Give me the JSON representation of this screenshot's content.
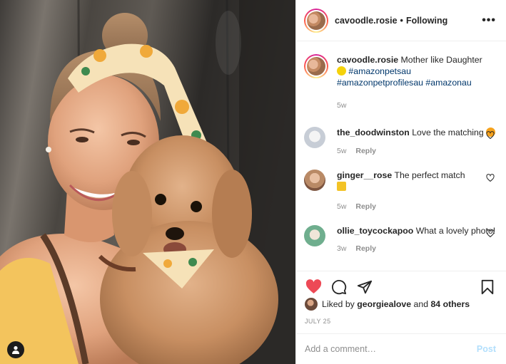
{
  "post": {
    "username": "cavoodle.rosie",
    "follow_status": "Following",
    "separator": "•",
    "more_label": "•••",
    "caption": {
      "username": "cavoodle.rosie",
      "text": "Mother like Daughter",
      "hashtags": [
        "#amazonpetsau",
        "#amazonpetprofilesau",
        "#amazonau"
      ],
      "age": "5w"
    },
    "comments": [
      {
        "username": "the_doodwinston",
        "text": "Love the matching",
        "age": "5w",
        "reply_label": "Reply",
        "avatar_color": "#c7cdd6"
      },
      {
        "username": "ginger__rose",
        "text": "The perfect match",
        "age": "5w",
        "reply_label": "Reply",
        "avatar_color": "#b98a66"
      },
      {
        "username": "ollie_toycockapoo",
        "text": "What a lovely photo!",
        "age": "3w",
        "reply_label": "Reply",
        "avatar_color": "#6fae8e"
      }
    ],
    "likes": {
      "prefix": "Liked by",
      "first_user": "georgiealove",
      "joiner": "and",
      "others": "84 others"
    },
    "date": "JULY 25",
    "add_comment_placeholder": "Add a comment…",
    "post_label": "Post"
  },
  "colors": {
    "liked_heart": "#ed4956",
    "link": "#00376b",
    "muted": "#8e8e8e",
    "post_disabled": "#b2dffc"
  },
  "icons": {
    "like": "heart-icon",
    "comment": "comment-bubble-icon",
    "share": "paper-plane-icon",
    "save": "bookmark-icon",
    "tags": "user-tag-icon",
    "comment_like": "heart-outline-icon"
  }
}
